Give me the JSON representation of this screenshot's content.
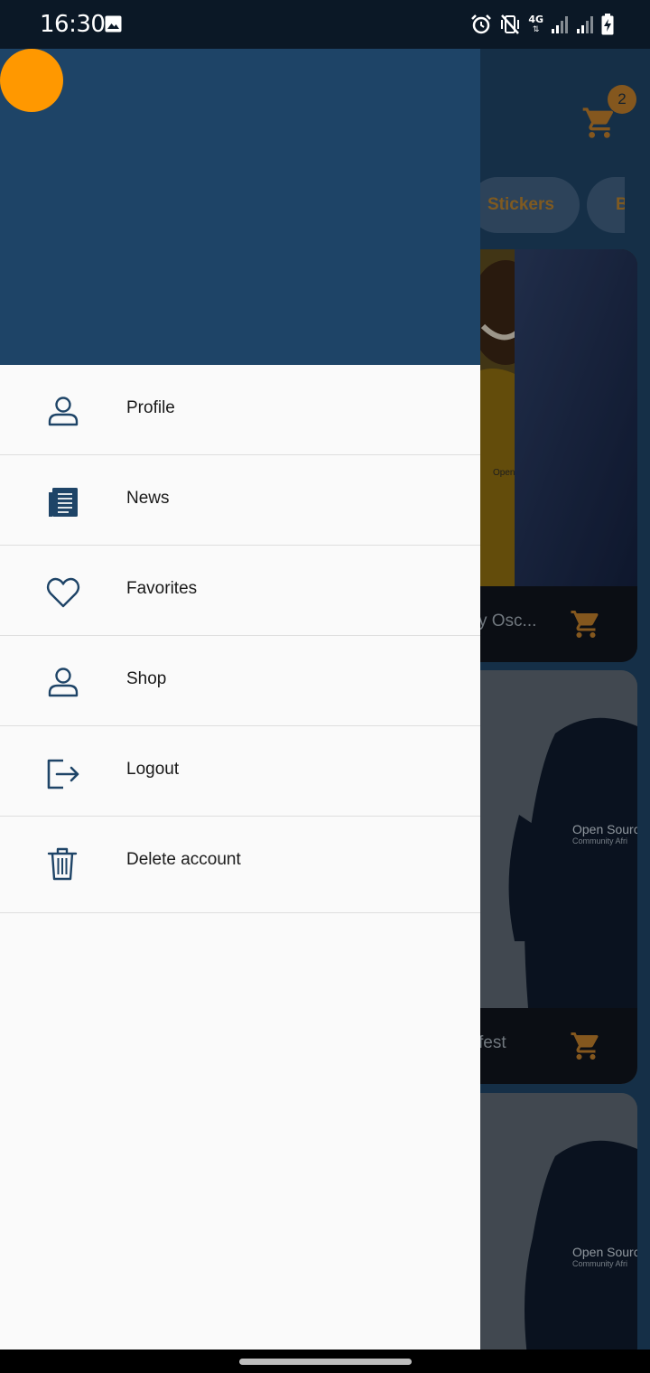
{
  "status_bar": {
    "time": "16:30",
    "network": "4G",
    "icons": [
      "image-icon",
      "alarm-icon",
      "vibrate-mute-icon",
      "signal-icon",
      "signal-icon",
      "battery-charging-icon"
    ]
  },
  "background_app": {
    "cart_badge": "2",
    "chips": [
      "Stickers",
      "B"
    ],
    "products": [
      {
        "title": "y Osc..."
      },
      {
        "title": "fest"
      },
      {
        "title": ""
      }
    ],
    "hoodie_print": {
      "line1": "Open Sourc",
      "line2": "Community Afri"
    }
  },
  "drawer": {
    "menu": [
      {
        "label": "Profile",
        "icon": "person-icon"
      },
      {
        "label": "News",
        "icon": "newspaper-icon"
      },
      {
        "label": "Favorites",
        "icon": "heart-icon"
      },
      {
        "label": "Shop",
        "icon": "person-icon"
      },
      {
        "label": "Logout",
        "icon": "logout-icon"
      },
      {
        "label": "Delete account",
        "icon": "trash-icon"
      }
    ]
  },
  "colors": {
    "drawer_header": "#1e4467",
    "avatar": "#ff9800",
    "icon": "#1e4467",
    "accent": "#b8792a"
  }
}
